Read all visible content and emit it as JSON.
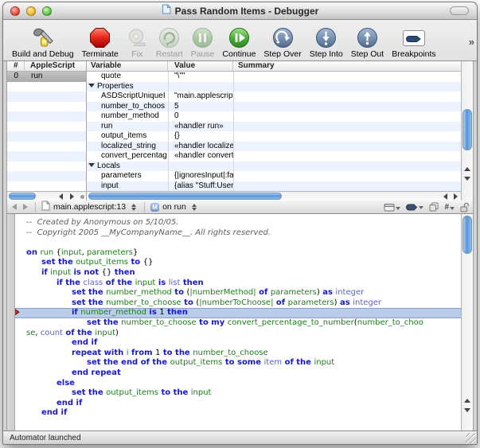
{
  "window": {
    "title": "Pass Random Items - Debugger",
    "traffic_lights": [
      "close",
      "minimize",
      "zoom"
    ]
  },
  "toolbar": {
    "overflow_glyph": "»",
    "items": [
      {
        "id": "build-and-debug",
        "label": "Build and Debug",
        "enabled": true
      },
      {
        "id": "terminate",
        "label": "Terminate",
        "enabled": true
      },
      {
        "id": "fix",
        "label": "Fix",
        "enabled": false
      },
      {
        "id": "restart",
        "label": "Restart",
        "enabled": false
      },
      {
        "id": "pause",
        "label": "Pause",
        "enabled": false
      },
      {
        "id": "continue",
        "label": "Continue",
        "enabled": true
      },
      {
        "id": "step-over",
        "label": "Step Over",
        "enabled": true
      },
      {
        "id": "step-into",
        "label": "Step Into",
        "enabled": true
      },
      {
        "id": "step-out",
        "label": "Step Out",
        "enabled": true
      },
      {
        "id": "breakpoints",
        "label": "Breakpoints",
        "enabled": true
      }
    ]
  },
  "stack_pane": {
    "columns": [
      "#",
      "AppleScript"
    ],
    "rows": [
      {
        "num": "0",
        "name": "run",
        "selected": true
      }
    ],
    "empty_row_count": 11
  },
  "variables_pane": {
    "columns": [
      "Variable",
      "Value",
      "Summary"
    ],
    "rows": [
      {
        "type": "item",
        "variable": "quote",
        "value": "\"\\\"\"",
        "summary": ""
      },
      {
        "type": "group",
        "variable": "Properties",
        "expanded": true
      },
      {
        "type": "item",
        "variable": "ASDScriptUniqueI",
        "value": "\"main.applescript",
        "summary": ""
      },
      {
        "type": "item",
        "variable": "number_to_choos",
        "value": "5",
        "summary": ""
      },
      {
        "type": "item",
        "variable": "number_method",
        "value": "0",
        "summary": ""
      },
      {
        "type": "item",
        "variable": "run",
        "value": "«handler run»",
        "summary": ""
      },
      {
        "type": "item",
        "variable": "output_items",
        "value": "{}",
        "summary": ""
      },
      {
        "type": "item",
        "variable": "localized_string",
        "value": "«handler localize",
        "summary": ""
      },
      {
        "type": "item",
        "variable": "convert_percentag",
        "value": "«handler convert",
        "summary": ""
      },
      {
        "type": "group",
        "variable": "Locals",
        "expanded": true
      },
      {
        "type": "item",
        "variable": "parameters",
        "value": "{|ignoresInput|:fa",
        "summary": ""
      },
      {
        "type": "item",
        "variable": "input",
        "value": "{alias \"Stuff:Users",
        "summary": ""
      }
    ]
  },
  "navbar": {
    "file_label": "main.applescript:13",
    "scope_label": "on run",
    "scope_icon_letter": "M",
    "right_icons": [
      "counterpart-icon",
      "breakpoint-pill-icon",
      "copy-icon",
      "line-numbers-icon",
      "lock-icon"
    ]
  },
  "code": {
    "colors": {
      "k": "#1717d1",
      "a": "#5b5fd0",
      "i": "#1e7d1e",
      "p": "#000000",
      "c": "#5e5e5e",
      "highlight_row": "#b9cce9"
    },
    "lines": [
      {
        "ind": 0,
        "hl": false,
        "seg": [
          [
            "c",
            "--  Created by Anonymous on 5/10/05."
          ]
        ]
      },
      {
        "ind": 0,
        "hl": false,
        "seg": [
          [
            "c",
            "--  Copyright 2005 __MyCompanyName__. All rights reserved."
          ]
        ]
      },
      {
        "ind": 0,
        "hl": false,
        "seg": [
          [
            "p",
            ""
          ]
        ]
      },
      {
        "ind": 0,
        "hl": false,
        "seg": [
          [
            "k",
            "on "
          ],
          [
            "i",
            "run"
          ],
          [
            "p",
            " {"
          ],
          [
            "i",
            "input"
          ],
          [
            "p",
            ", "
          ],
          [
            "i",
            "parameters"
          ],
          [
            "p",
            "}"
          ]
        ]
      },
      {
        "ind": 1,
        "hl": false,
        "seg": [
          [
            "k",
            "set the "
          ],
          [
            "i",
            "output_items"
          ],
          [
            "k",
            " to "
          ],
          [
            "p",
            "{}"
          ]
        ]
      },
      {
        "ind": 1,
        "hl": false,
        "seg": [
          [
            "k",
            "if "
          ],
          [
            "i",
            "input"
          ],
          [
            "k",
            " is not "
          ],
          [
            "p",
            "{}"
          ],
          [
            "k",
            " then"
          ]
        ]
      },
      {
        "ind": 2,
        "hl": false,
        "seg": [
          [
            "k",
            "if the "
          ],
          [
            "a",
            "class"
          ],
          [
            "k",
            " of the "
          ],
          [
            "i",
            "input"
          ],
          [
            "k",
            " is "
          ],
          [
            "a",
            "list"
          ],
          [
            "k",
            " then"
          ]
        ]
      },
      {
        "ind": 3,
        "hl": false,
        "seg": [
          [
            "k",
            "set the "
          ],
          [
            "i",
            "number_method"
          ],
          [
            "k",
            " to "
          ],
          [
            "p",
            "("
          ],
          [
            "i",
            "|numberMethod|"
          ],
          [
            "k",
            " of "
          ],
          [
            "i",
            "parameters"
          ],
          [
            "p",
            ")"
          ],
          [
            "k",
            " as "
          ],
          [
            "a",
            "integer"
          ]
        ]
      },
      {
        "ind": 3,
        "hl": false,
        "seg": [
          [
            "k",
            "set the "
          ],
          [
            "i",
            "number_to_choose"
          ],
          [
            "k",
            " to "
          ],
          [
            "p",
            "("
          ],
          [
            "i",
            "|numberToChoose|"
          ],
          [
            "k",
            " of "
          ],
          [
            "i",
            "parameters"
          ],
          [
            "p",
            ")"
          ],
          [
            "k",
            " as "
          ],
          [
            "a",
            "integer"
          ]
        ]
      },
      {
        "ind": 3,
        "hl": true,
        "seg": [
          [
            "k",
            "if "
          ],
          [
            "i",
            "number_method"
          ],
          [
            "k",
            " is "
          ],
          [
            "p",
            "1"
          ],
          [
            "k",
            " then"
          ]
        ]
      },
      {
        "ind": 4,
        "hl": false,
        "seg": [
          [
            "k",
            "set the "
          ],
          [
            "i",
            "number_to_choose"
          ],
          [
            "k",
            " to my "
          ],
          [
            "i",
            "convert_percentage_to_number"
          ],
          [
            "p",
            "("
          ],
          [
            "i",
            "number_to_choo"
          ]
        ]
      },
      {
        "ind": 0,
        "hl": false,
        "seg": [
          [
            "i",
            "se"
          ],
          [
            "p",
            ", "
          ],
          [
            "a",
            "count"
          ],
          [
            "k",
            " of the "
          ],
          [
            "i",
            "input"
          ],
          [
            "p",
            ")"
          ]
        ]
      },
      {
        "ind": 3,
        "hl": false,
        "seg": [
          [
            "k",
            "end if"
          ]
        ]
      },
      {
        "ind": 3,
        "hl": false,
        "seg": [
          [
            "k",
            "repeat with "
          ],
          [
            "i",
            "i"
          ],
          [
            "k",
            " from "
          ],
          [
            "p",
            "1"
          ],
          [
            "k",
            " to the "
          ],
          [
            "i",
            "number_to_choose"
          ]
        ]
      },
      {
        "ind": 4,
        "hl": false,
        "seg": [
          [
            "k",
            "set the end of the "
          ],
          [
            "i",
            "output_items"
          ],
          [
            "k",
            " to some "
          ],
          [
            "a",
            "item"
          ],
          [
            "k",
            " of the "
          ],
          [
            "i",
            "input"
          ]
        ]
      },
      {
        "ind": 3,
        "hl": false,
        "seg": [
          [
            "k",
            "end repeat"
          ]
        ]
      },
      {
        "ind": 2,
        "hl": false,
        "seg": [
          [
            "k",
            "else"
          ]
        ]
      },
      {
        "ind": 3,
        "hl": false,
        "seg": [
          [
            "k",
            "set the "
          ],
          [
            "i",
            "output_items"
          ],
          [
            "k",
            " to the "
          ],
          [
            "i",
            "input"
          ]
        ]
      },
      {
        "ind": 2,
        "hl": false,
        "seg": [
          [
            "k",
            "end if"
          ]
        ]
      },
      {
        "ind": 1,
        "hl": false,
        "seg": [
          [
            "k",
            "end if"
          ]
        ]
      }
    ]
  },
  "statusbar": {
    "text": "Automator launched"
  }
}
